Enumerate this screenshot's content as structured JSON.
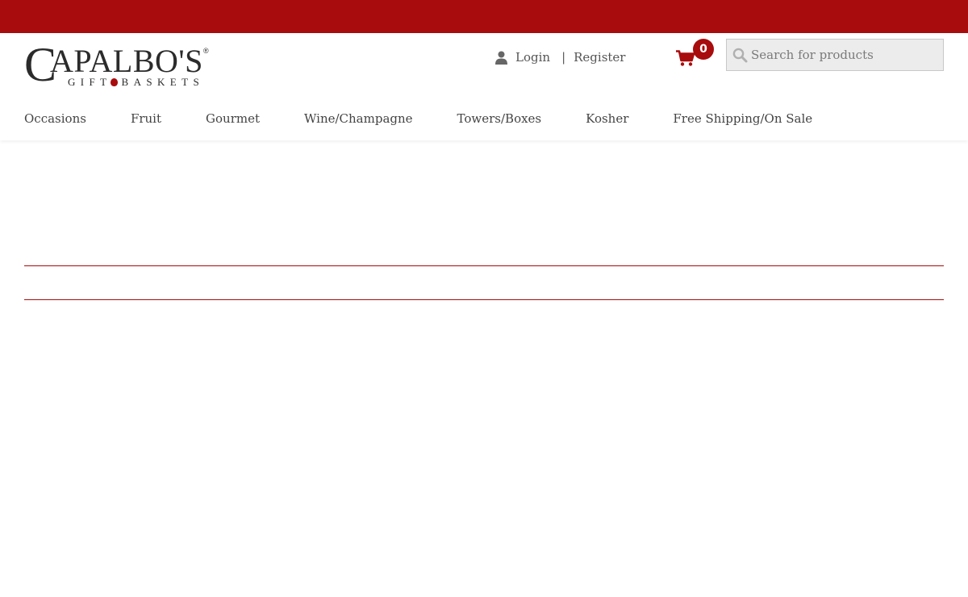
{
  "brand": {
    "logo_main_initial": "C",
    "logo_main_rest": "APALBO'S",
    "logo_registered": "®",
    "logo_sub_left": "GIFT",
    "logo_sub_right": "BASKETS"
  },
  "account": {
    "icon": "user-icon",
    "login_label": "Login",
    "separator": "|",
    "register_label": "Register"
  },
  "cart": {
    "icon": "shopping-cart-icon",
    "count": "0"
  },
  "search": {
    "icon": "search-icon",
    "placeholder": "Search for products",
    "value": ""
  },
  "nav": {
    "items": [
      {
        "label": "Occasions"
      },
      {
        "label": "Fruit"
      },
      {
        "label": "Gourmet"
      },
      {
        "label": "Wine/Champagne"
      },
      {
        "label": "Towers/Boxes"
      },
      {
        "label": "Kosher"
      },
      {
        "label": "Free Shipping/On Sale"
      }
    ]
  },
  "colors": {
    "brand_red": "#a80c0d",
    "text": "#444444",
    "search_bg": "#ececec"
  }
}
